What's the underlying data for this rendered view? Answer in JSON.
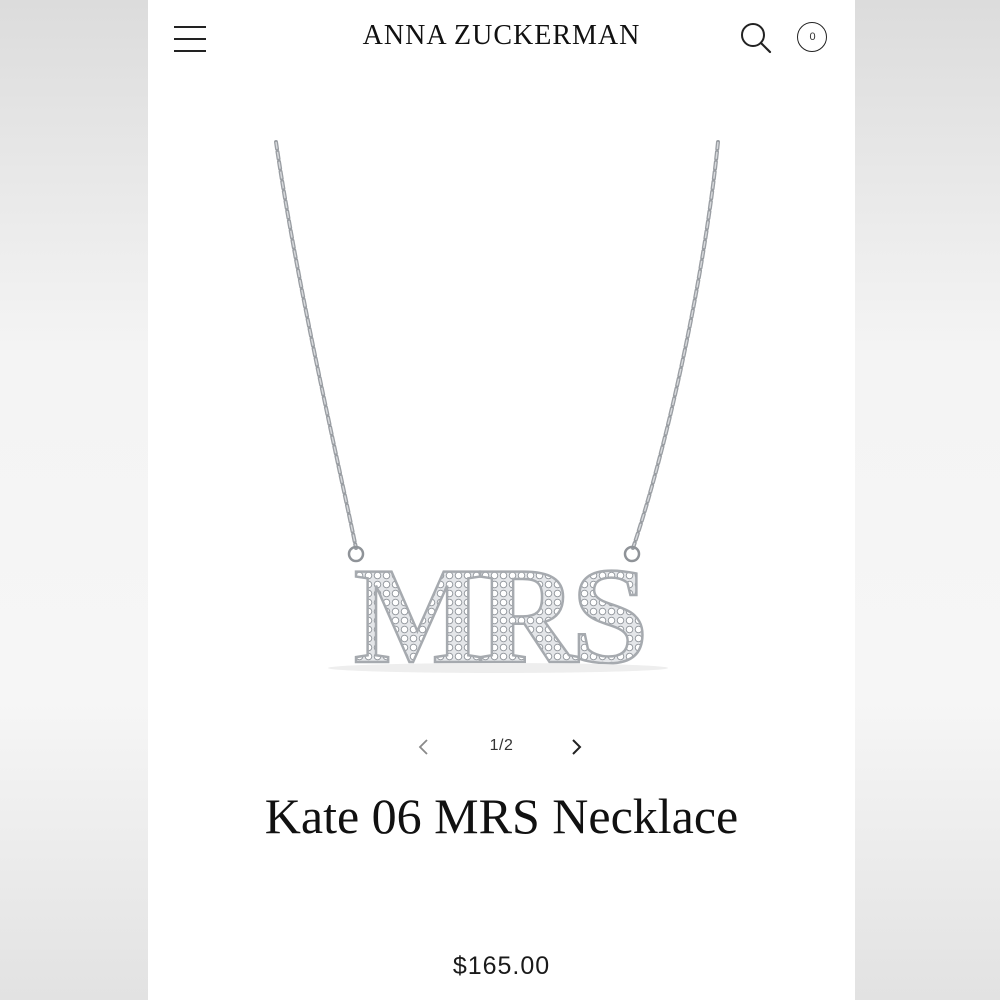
{
  "header": {
    "brand": "ANNA ZUCKERMAN",
    "menu_icon": "hamburger-menu-icon",
    "search_icon": "search-icon",
    "cart_icon": "cart-icon",
    "cart_count": "0"
  },
  "gallery": {
    "counter": "1/2",
    "prev_icon": "chevron-left-icon",
    "next_icon": "chevron-right-icon",
    "current_index": 1,
    "total": 2
  },
  "product": {
    "title": "Kate 06 MRS Necklace",
    "price": "$165.00",
    "pendant_text": "MRS"
  },
  "colors": {
    "background": "#ffffff",
    "text": "#111111",
    "metal": "#b9bcc1"
  }
}
